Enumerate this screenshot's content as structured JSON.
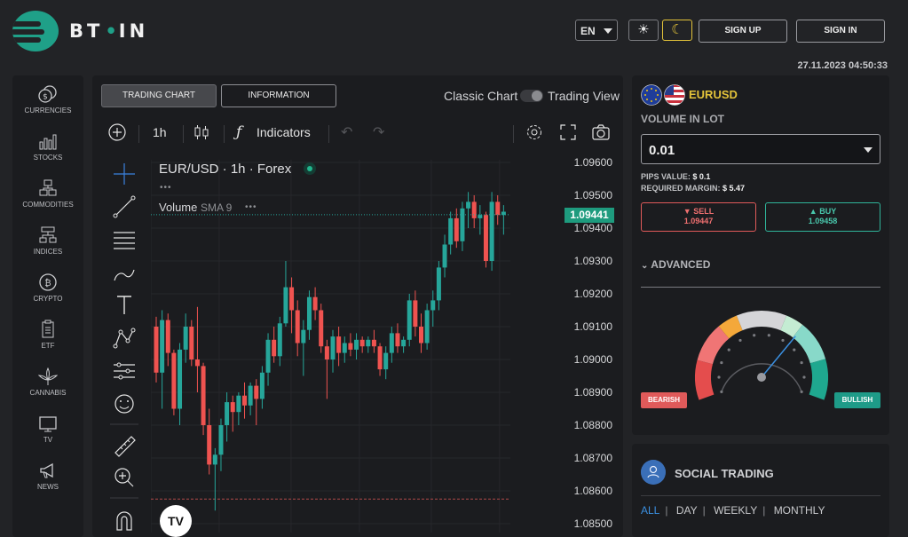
{
  "header": {
    "brand": "BT•IN",
    "language": "EN",
    "sign_up": "SIGN UP",
    "sign_in": "SIGN IN",
    "timestamp": "27.11.2023 04:50:33",
    "theme_light_icon": "sun-icon",
    "theme_dark_icon": "moon-icon"
  },
  "sidebar": {
    "items": [
      {
        "label": "CURRENCIES",
        "icon": "coins-icon"
      },
      {
        "label": "STOCKS",
        "icon": "bar-chart-icon"
      },
      {
        "label": "COMMODITIES",
        "icon": "boxes-icon"
      },
      {
        "label": "INDICES",
        "icon": "hierarchy-icon"
      },
      {
        "label": "CRYPTO",
        "icon": "bitcoin-icon"
      },
      {
        "label": "ETF",
        "icon": "document-icon"
      },
      {
        "label": "CANNABIS",
        "icon": "leaf-icon"
      },
      {
        "label": "TV",
        "icon": "tv-icon"
      },
      {
        "label": "NEWS",
        "icon": "megaphone-icon"
      }
    ]
  },
  "chart_panel": {
    "tab_trading_chart": "TRADING CHART",
    "tab_information": "INFORMATION",
    "classic_chart": "Classic Chart",
    "trading_view": "Trading View",
    "interval": "1h",
    "indicators": "Indicators",
    "symbol_legend": "EUR/USD · 1h · Forex",
    "volume_label": "Volume",
    "volume_sma": "SMA 9",
    "current_price": "1.09441",
    "tv_logo": "TV"
  },
  "chart_data": {
    "type": "candlestick",
    "symbol": "EUR/USD",
    "interval": "1h",
    "ylim": [
      1.085,
      1.096
    ],
    "y_ticks": [
      "1.09600",
      "1.09500",
      "1.09400",
      "1.09300",
      "1.09200",
      "1.09100",
      "1.09000",
      "1.08900",
      "1.08800",
      "1.08700",
      "1.08600",
      "1.08500"
    ],
    "current_price": 1.09441,
    "candles": [
      [
        1.091,
        1.0913,
        1.0893,
        1.0896
      ],
      [
        1.0896,
        1.0915,
        1.0885,
        1.0912
      ],
      [
        1.0912,
        1.0914,
        1.0898,
        1.0902
      ],
      [
        1.0902,
        1.0903,
        1.0883,
        1.0885
      ],
      [
        1.0885,
        1.0905,
        1.088,
        1.0903
      ],
      [
        1.0903,
        1.0914,
        1.0899,
        1.091
      ],
      [
        1.091,
        1.0912,
        1.0898,
        1.09
      ],
      [
        1.09,
        1.0916,
        1.089,
        1.0898
      ],
      [
        1.0898,
        1.0899,
        1.0877,
        1.088
      ],
      [
        1.088,
        1.0885,
        1.0865,
        1.0868
      ],
      [
        1.0868,
        1.0873,
        1.0854,
        1.0871
      ],
      [
        1.0871,
        1.0882,
        1.0866,
        1.088
      ],
      [
        1.088,
        1.089,
        1.0875,
        1.0887
      ],
      [
        1.0887,
        1.0889,
        1.0878,
        1.0884
      ],
      [
        1.0884,
        1.089,
        1.088,
        1.0889
      ],
      [
        1.0889,
        1.0893,
        1.0882,
        1.0886
      ],
      [
        1.0886,
        1.0893,
        1.0883,
        1.0892
      ],
      [
        1.0892,
        1.0894,
        1.088,
        1.0888
      ],
      [
        1.0888,
        1.0898,
        1.0885,
        1.0896
      ],
      [
        1.0896,
        1.0908,
        1.0892,
        1.0906
      ],
      [
        1.0906,
        1.091,
        1.0899,
        1.0901
      ],
      [
        1.0901,
        1.0913,
        1.0898,
        1.0911
      ],
      [
        1.0911,
        1.093,
        1.091,
        1.0922
      ],
      [
        1.0922,
        1.0925,
        1.0908,
        1.0915
      ],
      [
        1.0915,
        1.0918,
        1.0901,
        1.0905
      ],
      [
        1.0905,
        1.0912,
        1.0895,
        1.0909
      ],
      [
        1.0909,
        1.0921,
        1.0906,
        1.0919
      ],
      [
        1.0919,
        1.0922,
        1.0912,
        1.0915
      ],
      [
        1.0915,
        1.0917,
        1.0902,
        1.0904
      ],
      [
        1.0904,
        1.0906,
        1.0888,
        1.09
      ],
      [
        1.09,
        1.0909,
        1.0896,
        1.0907
      ],
      [
        1.0907,
        1.091,
        1.0898,
        1.0902
      ],
      [
        1.0902,
        1.0907,
        1.0899,
        1.0905
      ],
      [
        1.0905,
        1.0908,
        1.0901,
        1.0903
      ],
      [
        1.0903,
        1.0908,
        1.09,
        1.0906
      ],
      [
        1.0906,
        1.0907,
        1.0902,
        1.0904
      ],
      [
        1.0904,
        1.0907,
        1.0902,
        1.0906
      ],
      [
        1.0906,
        1.0909,
        1.0902,
        1.0904
      ],
      [
        1.0904,
        1.0905,
        1.0895,
        1.0897
      ],
      [
        1.0897,
        1.0904,
        1.0894,
        1.0902
      ],
      [
        1.0902,
        1.091,
        1.0899,
        1.0908
      ],
      [
        1.0908,
        1.0911,
        1.0902,
        1.0904
      ],
      [
        1.0904,
        1.0907,
        1.0902,
        1.0906
      ],
      [
        1.0906,
        1.092,
        1.0904,
        1.0918
      ],
      [
        1.0918,
        1.0921,
        1.0907,
        1.091
      ],
      [
        1.091,
        1.0914,
        1.0902,
        1.0905
      ],
      [
        1.0905,
        1.0917,
        1.0903,
        1.0915
      ],
      [
        1.0915,
        1.0921,
        1.091,
        1.0918
      ],
      [
        1.0918,
        1.093,
        1.0915,
        1.0928
      ],
      [
        1.0928,
        1.0938,
        1.0925,
        1.0935
      ],
      [
        1.0935,
        1.0945,
        1.0932,
        1.0943
      ],
      [
        1.0943,
        1.0946,
        1.0934,
        1.0936
      ],
      [
        1.0936,
        1.0948,
        1.0933,
        1.0946
      ],
      [
        1.0946,
        1.0951,
        1.094,
        1.0948
      ],
      [
        1.0948,
        1.095,
        1.094,
        1.0943
      ],
      [
        1.0943,
        1.0947,
        1.0938,
        1.0944
      ],
      [
        1.0944,
        1.0945,
        1.0928,
        1.093
      ],
      [
        1.093,
        1.0951,
        1.0927,
        1.0948
      ],
      [
        1.0948,
        1.095,
        1.0941,
        1.0944
      ],
      [
        1.0944,
        1.0947,
        1.0938,
        1.0945
      ]
    ]
  },
  "trade": {
    "pair": "EURUSD",
    "volume_label": "VOLUME IN LOT",
    "lot_value": "0.01",
    "pips_label": "PIPS VALUE:",
    "pips_value": "$ 0.1",
    "margin_label": "REQUIRED MARGIN:",
    "margin_value": "$ 5.47",
    "sell_label": "SELL",
    "sell_price": "1.09447",
    "buy_label": "BUY",
    "buy_price": "1.09458",
    "advanced": "ADVANCED",
    "bearish": "BEARISH",
    "bullish": "BULLISH",
    "sentiment": 0.68,
    "colors": {
      "sell": "#e05a5a",
      "buy": "#2fb49a",
      "accent": "#e3c33a"
    }
  },
  "social": {
    "title": "SOCIAL TRADING",
    "filters": [
      "ALL",
      "DAY",
      "WEEKLY",
      "MONTHLY"
    ]
  }
}
